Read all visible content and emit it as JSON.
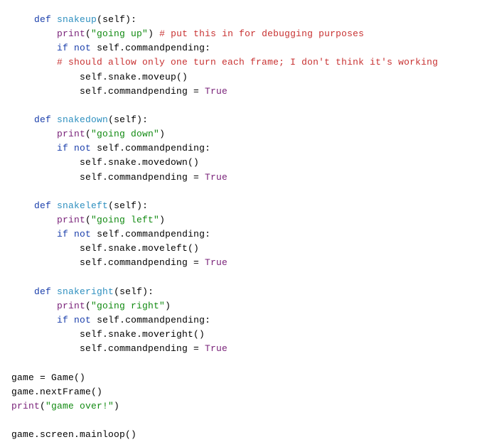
{
  "fn1": {
    "def": "def",
    "name": "snakeup",
    "sig": "(self):"
  },
  "fn1_print": {
    "call": "print",
    "open": "(",
    "str": "\"going up\"",
    "close": ")",
    "c1": " # put this in for debugging purposes"
  },
  "fn1_if": {
    "kw_if": "if",
    "kw_not": "not",
    "expr": " self.commandpending:"
  },
  "fn1_c2": "# should allow only one turn each frame; I don't think it's working",
  "fn1_b1": "self.snake.moveup()",
  "fn1_b2a": "self.commandpending = ",
  "fn1_b2b": "True",
  "fn2": {
    "def": "def",
    "name": "snakedown",
    "sig": "(self):"
  },
  "fn2_print": {
    "call": "print",
    "open": "(",
    "str": "\"going down\"",
    "close": ")"
  },
  "fn2_if": {
    "kw_if": "if",
    "kw_not": "not",
    "expr": " self.commandpending:"
  },
  "fn2_b1": "self.snake.movedown()",
  "fn2_b2a": "self.commandpending = ",
  "fn2_b2b": "True",
  "fn3": {
    "def": "def",
    "name": "snakeleft",
    "sig": "(self):"
  },
  "fn3_print": {
    "call": "print",
    "open": "(",
    "str": "\"going left\"",
    "close": ")"
  },
  "fn3_if": {
    "kw_if": "if",
    "kw_not": "not",
    "expr": " self.commandpending:"
  },
  "fn3_b1": "self.snake.moveleft()",
  "fn3_b2a": "self.commandpending = ",
  "fn3_b2b": "True",
  "fn4": {
    "def": "def",
    "name": "snakeright",
    "sig": "(self):"
  },
  "fn4_print": {
    "call": "print",
    "open": "(",
    "str": "\"going right\"",
    "close": ")"
  },
  "fn4_if": {
    "kw_if": "if",
    "kw_not": "not",
    "expr": " self.commandpending:"
  },
  "fn4_b1": "self.snake.moveright()",
  "fn4_b2a": "self.commandpending = ",
  "fn4_b2b": "True",
  "tail1": "game = Game()",
  "tail2": "game.nextFrame()",
  "tail3": {
    "call": "print",
    "open": "(",
    "str": "\"game over!\"",
    "close": ")"
  },
  "tail4": "game.screen.mainloop()"
}
